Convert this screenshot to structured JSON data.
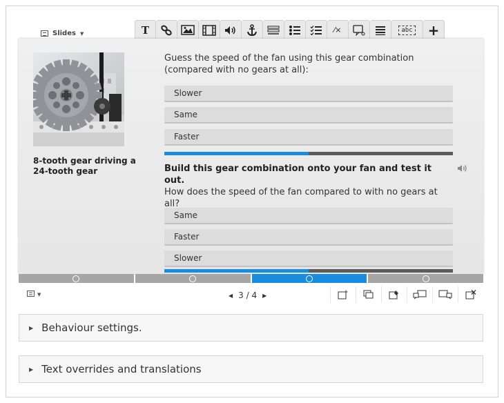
{
  "header": {
    "slides_label": "Slides",
    "toolbar": [
      {
        "name": "text-tool",
        "glyph": "T"
      },
      {
        "name": "link-tool",
        "glyph": ""
      },
      {
        "name": "image-tool",
        "glyph": ""
      },
      {
        "name": "video-tool",
        "glyph": ""
      },
      {
        "name": "audio-tool",
        "glyph": ""
      },
      {
        "name": "anchor-tool",
        "glyph": ""
      },
      {
        "name": "fill-blanks-tool",
        "glyph": ""
      },
      {
        "name": "multiple-choice-tool",
        "glyph": ""
      },
      {
        "name": "single-choice-set-tool",
        "glyph": ""
      },
      {
        "name": "true-false-tool",
        "glyph": "⁄×"
      },
      {
        "name": "dialog-cards-tool",
        "glyph": ""
      },
      {
        "name": "list-tool",
        "glyph": ""
      },
      {
        "name": "drag-text-tool",
        "glyph": "abc"
      },
      {
        "name": "more-tools",
        "glyph": "+"
      }
    ]
  },
  "slide": {
    "image_caption": "8-tooth gear driving a 24-tooth gear",
    "question1": {
      "text": "Guess the speed of the fan using this gear combination (compared with no gears at all):",
      "options": [
        "Slower",
        "Same",
        "Faster"
      ],
      "progress": 0.5
    },
    "question2": {
      "bold_text": "Build this gear combination onto your fan and test it out.",
      "text": "How does the speed of the fan compared to with no gears at all?",
      "options": [
        "Same",
        "Faster",
        "Slower"
      ],
      "progress": 0.5
    }
  },
  "navigation": {
    "slide_count": 4,
    "active_slide": 3,
    "pager_text": "3 / 4"
  },
  "panels": {
    "behaviour": "Behaviour settings.",
    "text_overrides": "Text overrides and translations"
  },
  "colors": {
    "accent": "#1a8ce0",
    "progress_track": "#5c5c5c",
    "nav_inactive": "#a6a6a6"
  }
}
